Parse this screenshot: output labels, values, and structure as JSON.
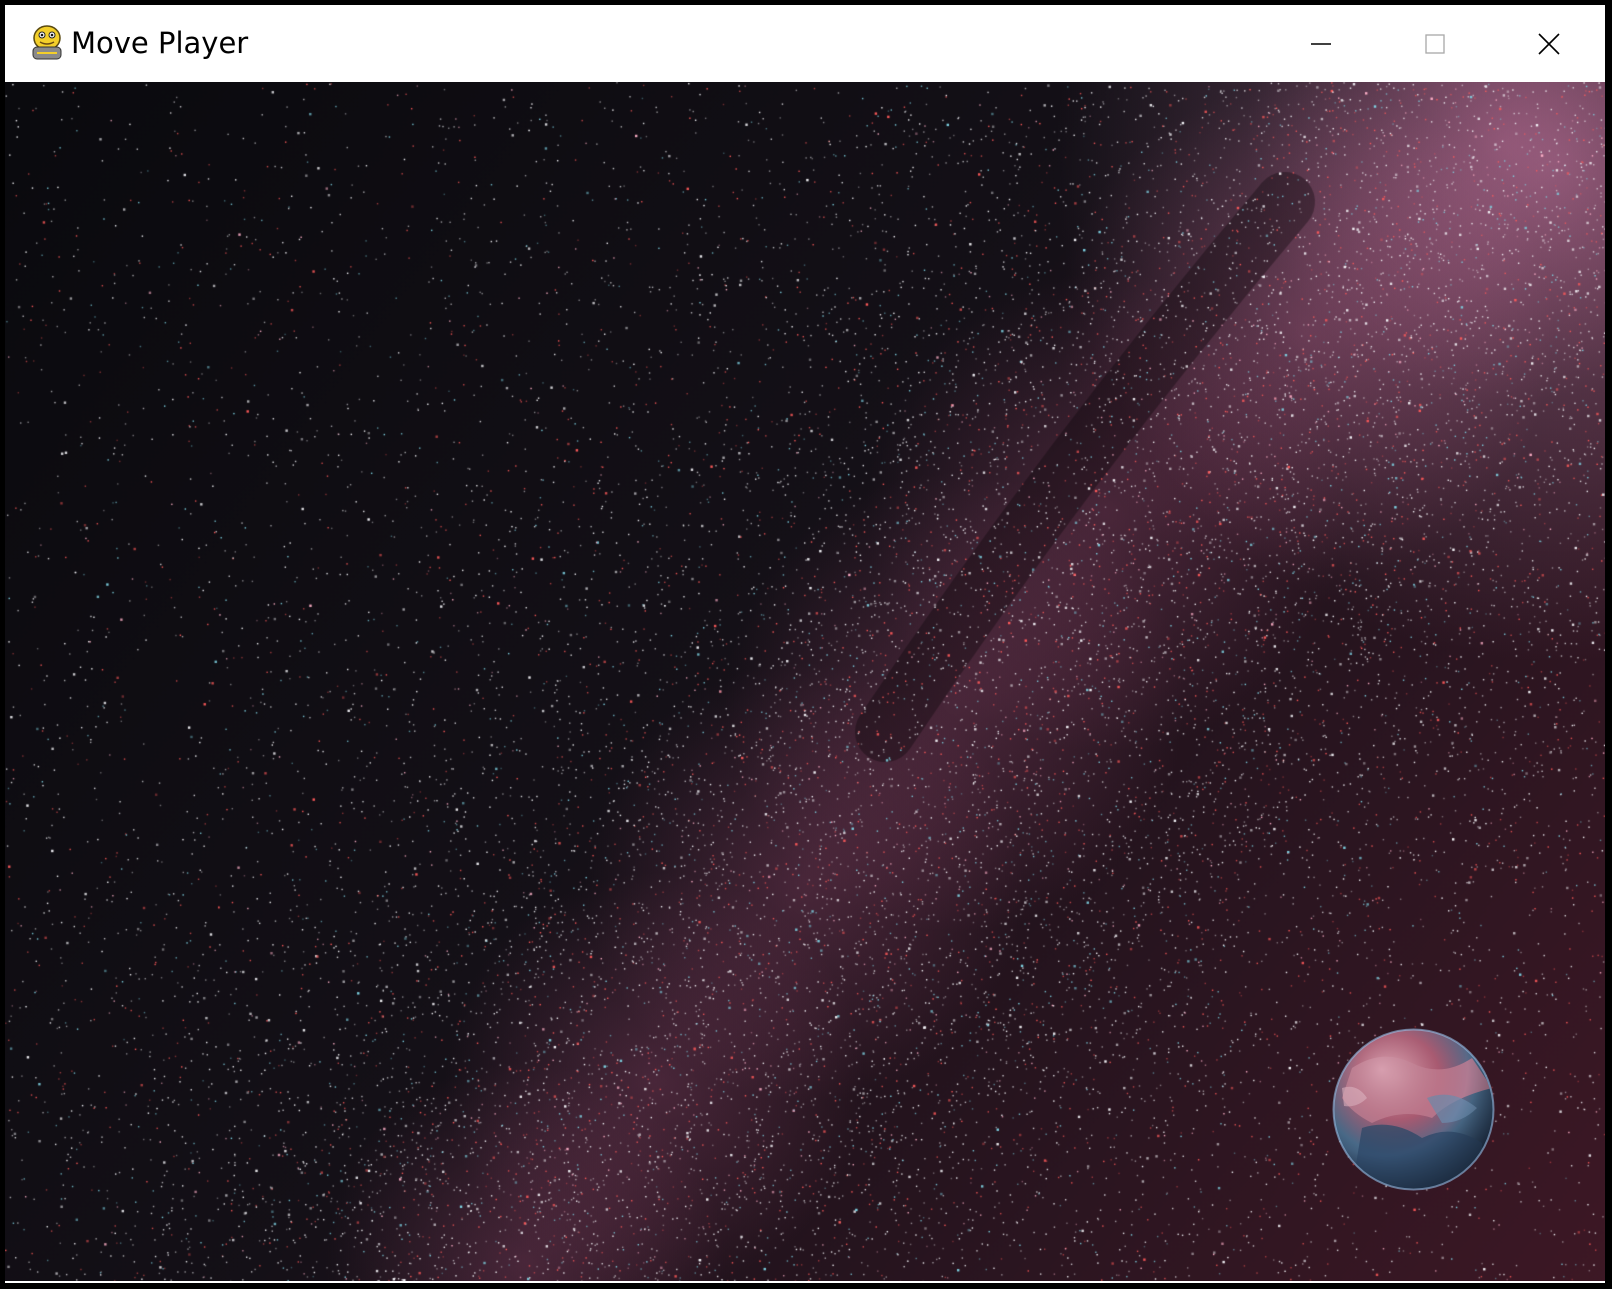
{
  "window": {
    "title": "Move Player",
    "app_icon": "pygame-snake-icon",
    "controls": {
      "minimize": "minimize-icon",
      "maximize": "maximize-icon",
      "close": "close-icon"
    }
  },
  "scene": {
    "background": "starfield-milky-way",
    "player": "planet-earth-sprite"
  },
  "colors": {
    "titlebar": "#ffffff",
    "sky_dark": "#0c0b10",
    "nebula_pink": "#8a4a66",
    "nebula_red": "#5a1f2e",
    "star_white": "#f4f4f8",
    "star_cyan": "#7fd6e6",
    "star_red": "#ff5a5a"
  }
}
